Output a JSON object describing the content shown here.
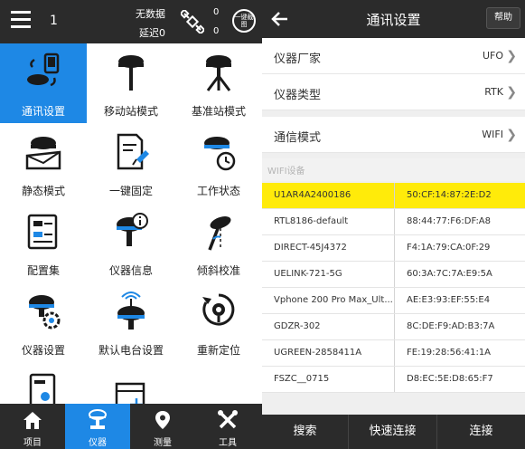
{
  "left": {
    "topbar": {
      "instrument_no": "1",
      "status_line1": "无数据",
      "status_line2": "延迟0",
      "count1": "0",
      "count2": "0",
      "snapshot_label": "一键截图"
    },
    "grid": [
      {
        "label": "通讯设置",
        "icon": "receiver-phone-sync-icon",
        "active": true
      },
      {
        "label": "移动站模式",
        "icon": "rover-pole-icon",
        "active": false
      },
      {
        "label": "基准站模式",
        "icon": "base-tripod-icon",
        "active": false
      },
      {
        "label": "静态模式",
        "icon": "static-receiver-icon",
        "active": false
      },
      {
        "label": "一键固定",
        "icon": "document-pin-icon",
        "active": false
      },
      {
        "label": "工作状态",
        "icon": "receiver-clock-icon",
        "active": false
      },
      {
        "label": "配置集",
        "icon": "config-set-icon",
        "active": false
      },
      {
        "label": "仪器信息",
        "icon": "receiver-info-icon",
        "active": false
      },
      {
        "label": "倾斜校准",
        "icon": "tilt-calibration-icon",
        "active": false
      },
      {
        "label": "仪器设置",
        "icon": "receiver-gear-icon",
        "active": false
      },
      {
        "label": "默认电台设置",
        "icon": "radio-antenna-icon",
        "active": false
      },
      {
        "label": "重新定位",
        "icon": "relocate-icon",
        "active": false
      },
      {
        "label": "",
        "icon": "user-document-icon",
        "active": false
      },
      {
        "label": "",
        "icon": "add-window-icon",
        "active": false
      }
    ],
    "nav": [
      {
        "label": "项目",
        "icon": "home-icon",
        "active": false
      },
      {
        "label": "仪器",
        "icon": "instrument-icon",
        "active": true
      },
      {
        "label": "测量",
        "icon": "map-pin-icon",
        "active": false
      },
      {
        "label": "工具",
        "icon": "tools-icon",
        "active": false
      }
    ]
  },
  "right": {
    "title": "通讯设置",
    "help_label": "帮助",
    "rows": [
      {
        "label": "仪器厂家",
        "value": "UFO"
      },
      {
        "label": "仪器类型",
        "value": "RTK"
      },
      {
        "label": "通信模式",
        "value": "WIFI"
      }
    ],
    "section_label": "WIFI设备",
    "devices": [
      {
        "name": "U1AR4A2400186",
        "mac": "50:CF:14:87:2E:D2",
        "selected": true
      },
      {
        "name": "RTL8186-default",
        "mac": "88:44:77:F6:DF:A8",
        "selected": false
      },
      {
        "name": "DIRECT-45J4372",
        "mac": "F4:1A:79:CA:0F:29",
        "selected": false
      },
      {
        "name": "UELINK-721-5G",
        "mac": "60:3A:7C:7A:E9:5A",
        "selected": false
      },
      {
        "name": "Vphone 200 Pro Max_Ult...",
        "mac": "AE:E3:93:EF:55:E4",
        "selected": false
      },
      {
        "name": "GDZR-302",
        "mac": "8C:DE:F9:AD:B3:7A",
        "selected": false
      },
      {
        "name": "UGREEN-2858411A",
        "mac": "FE:19:28:56:41:1A",
        "selected": false
      },
      {
        "name": "FSZC__0715",
        "mac": "D8:EC:5E:D8:65:F7",
        "selected": false
      }
    ],
    "buttons": [
      "搜索",
      "快速连接",
      "连接"
    ]
  },
  "colors": {
    "accent": "#1e88e5",
    "dark_bar": "#2b2b2b",
    "selected_row": "#ffeb0a"
  }
}
